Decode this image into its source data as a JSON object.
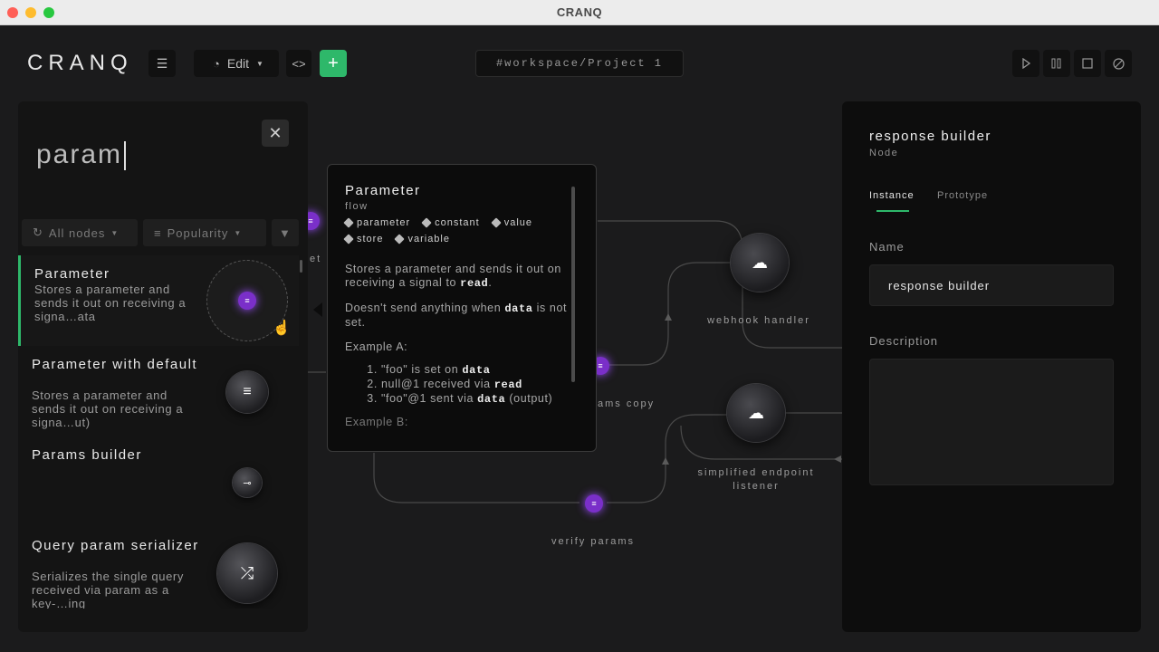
{
  "window": {
    "title": "CRANQ"
  },
  "toolbar": {
    "logo": "CRANQ",
    "mode_label": "Edit",
    "add_label": "+",
    "code_label": "<>",
    "path": "#workspace/Project 1"
  },
  "search": {
    "query": "param",
    "filter_nodes": "All nodes",
    "filter_sort": "Popularity",
    "results": [
      {
        "title": "Parameter",
        "desc": "Stores a parameter and sends it out on receiving a signa…ata"
      },
      {
        "title": "Parameter with default",
        "desc": "Stores a parameter and sends it out on receiving a signa…ut)"
      },
      {
        "title": "Params builder",
        "desc": ""
      },
      {
        "title": "Query param serializer",
        "desc": "Serializes the single query received via param as a key-…ing"
      }
    ]
  },
  "popover": {
    "title": "Parameter",
    "category": "flow",
    "tags": [
      "parameter",
      "constant",
      "value",
      "store",
      "variable"
    ],
    "desc1_a": "Stores a parameter and sends it out on receiving a signal to ",
    "desc1_code": "read",
    "desc1_b": ".",
    "desc2_a": "Doesn't send anything when ",
    "desc2_code": "data",
    "desc2_b": " is not set.",
    "example_a": "Example A:",
    "steps": [
      {
        "a": "\"foo\" is set on ",
        "code": "data",
        "b": ""
      },
      {
        "a": "null@1 received via ",
        "code": "read",
        "b": ""
      },
      {
        "a": "\"foo\"@1 sent via ",
        "code": "data",
        "b": " (output)"
      }
    ],
    "example_b": "Example B:"
  },
  "canvas": {
    "labels": {
      "partial_left": "et",
      "webhook": "webhook handler",
      "params_copy": "ams copy",
      "simplified": "simplified endpoint listener",
      "verify": "verify params"
    }
  },
  "inspector": {
    "title": "response builder",
    "subtitle": "Node",
    "tab_instance": "Instance",
    "tab_prototype": "Prototype",
    "name_label": "Name",
    "name_value": "response builder",
    "description_label": "Description",
    "description_value": ""
  },
  "colors": {
    "accent": "#2eb86a",
    "param_node": "#7a2fc9"
  }
}
